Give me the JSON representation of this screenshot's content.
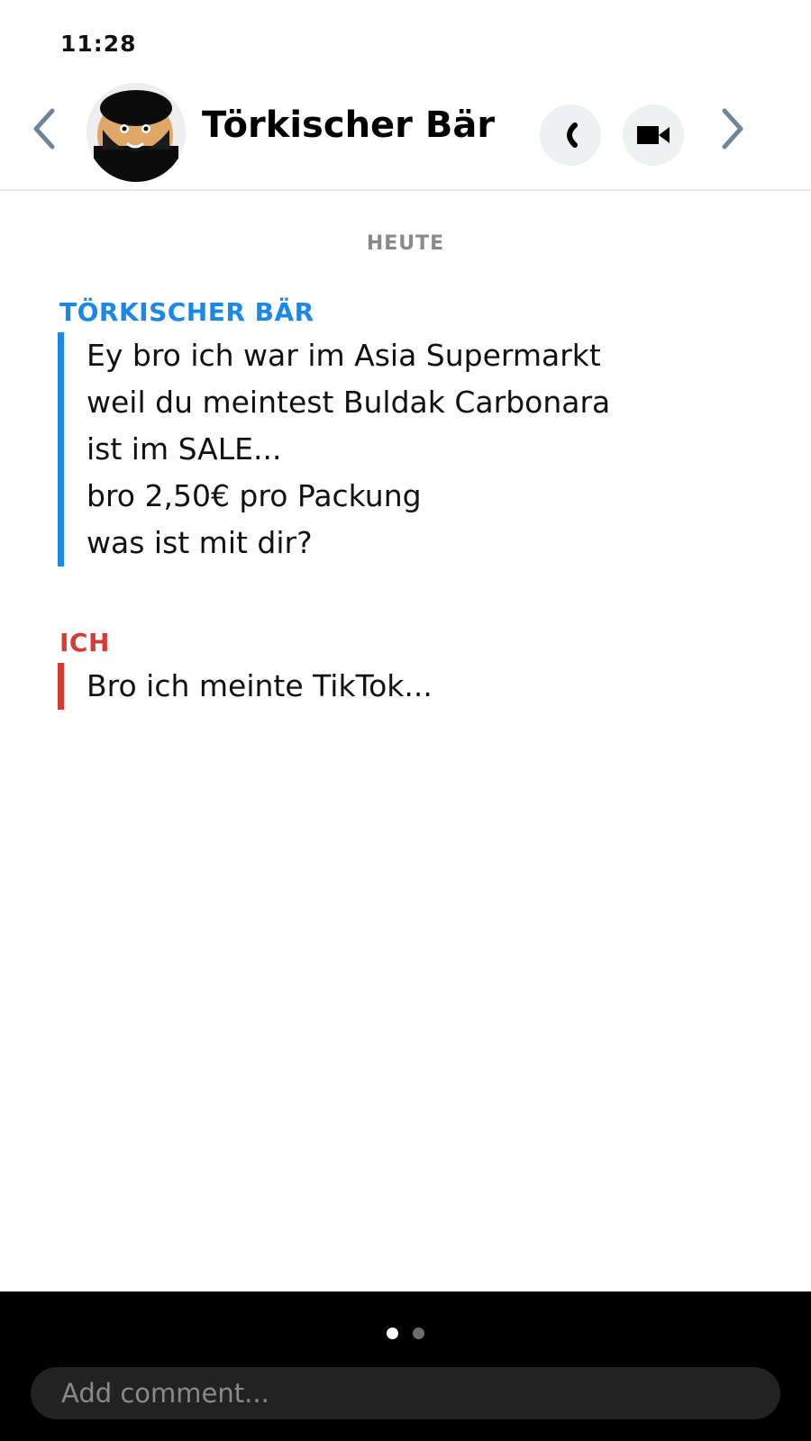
{
  "status_bar": {
    "time": "11:28"
  },
  "header": {
    "contact_name": "Törkischer Bär",
    "back_icon": "chevron-left-icon",
    "call_icon": "phone-icon",
    "video_icon": "video-camera-icon",
    "next_icon": "chevron-right-icon"
  },
  "chat": {
    "date_divider": "HEUTE",
    "messages": [
      {
        "sender": "TÖRKISCHER BÄR",
        "color": "#1a88e8",
        "lines": [
          "Ey bro ich war im Asia Supermarkt",
          "weil du meintest Buldak Carbonara",
          "ist im SALE...",
          "bro 2,50€ pro Packung",
          "was ist mit dir?"
        ]
      },
      {
        "sender": "ICH",
        "color": "#d63a32",
        "lines": [
          "Bro ich meinte TikTok..."
        ]
      }
    ]
  },
  "bottom": {
    "page_dots": {
      "count": 2,
      "active_index": 0
    },
    "comment_placeholder": "Add comment..."
  }
}
